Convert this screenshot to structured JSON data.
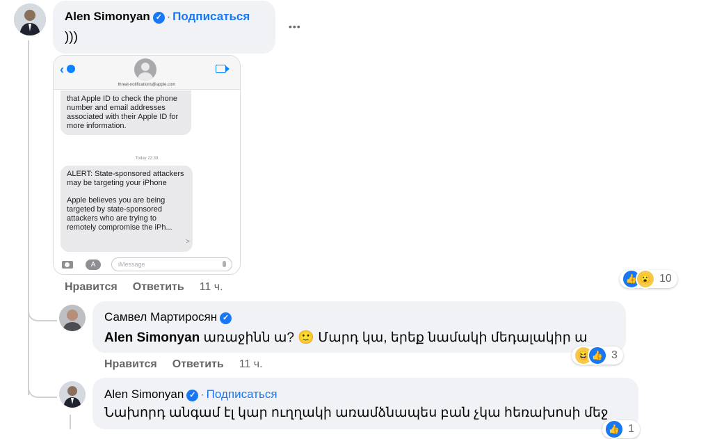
{
  "comment1": {
    "author": "Alen Simonyan",
    "separator": "·",
    "subscribe": "Подписаться",
    "text": ")))",
    "menu": "•••",
    "screenshot": {
      "sender": "threat-notifications@apple.com",
      "msg1": "that Apple ID to check the phone number and email addresses associated with their Apple ID for more information.",
      "timestamp": "Today 22:39",
      "msg2a": "ALERT: State-sponsored attackers may be targeting your iPhone",
      "msg2b": "Apple believes you are being targeted by state-sponsored attackers who are trying to remotely compromise the iPh...",
      "msg2_more": ">",
      "input_placeholder": "iMessage"
    },
    "like": "Нравится",
    "reply": "Ответить",
    "time": "11 ч.",
    "reaction_count": "10"
  },
  "reply1": {
    "author": "Самвел Мартиросян",
    "mention": "Alen Simonyan",
    "text_a": "առաջինն ա?",
    "emoji": "🙂",
    "text_b": "Մարդ կա, երեք նամակի մեդալակիր ա",
    "like": "Нравится",
    "reply": "Ответить",
    "time": "11 ч.",
    "reaction_count": "3"
  },
  "reply2": {
    "author": "Alen Simonyan",
    "separator": "·",
    "subscribe": "Подписаться",
    "text": "Նախորդ անգամ էլ կար ուղղակի առամձնապես բան չկա հեռախոսի մեջ",
    "reaction_count_partial": "1"
  },
  "colors": {
    "link_blue": "#1877f2",
    "bubble_bg": "#f0f2f5",
    "meta_gray": "#65676b"
  }
}
